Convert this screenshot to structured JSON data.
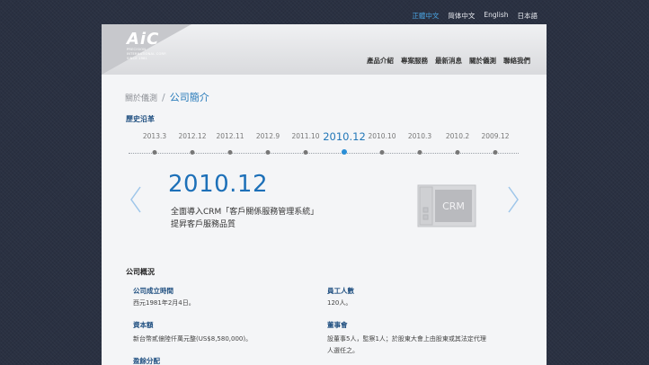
{
  "languages": [
    {
      "label": "正體中文",
      "active": true
    },
    {
      "label": "简体中文",
      "active": false
    },
    {
      "label": "English",
      "active": false
    },
    {
      "label": "日本語",
      "active": false
    }
  ],
  "logo": {
    "text": "AiC",
    "line1": "PRECISION INTERNATIONAL CORP.",
    "line2": "SINCE 1981"
  },
  "nav": [
    "產品介紹",
    "專案服務",
    "最新消息",
    "關於儀測",
    "聯絡我們"
  ],
  "breadcrumb": {
    "parent": "關於儀測",
    "separator": "/",
    "current": "公司簡介"
  },
  "history": {
    "title": "歷史沿革",
    "years": [
      "2013.3",
      "2012.12",
      "2012.11",
      "2012.9",
      "2011.10",
      "2010.12",
      "2010.10",
      "2010.3",
      "2010.2",
      "2009.12"
    ],
    "active_index": 5,
    "active_year": "2010.12",
    "lines": [
      "全面導入CRM「客戶關係服務管理系統」",
      "提昇客戶服務品質"
    ],
    "icon_label": "CRM",
    "icon_name": "crm-icon"
  },
  "overview": {
    "title": "公司概況",
    "founded_label": "公司成立時間",
    "founded_value": "西元1981年2月4日。",
    "employees_label": "員工人數",
    "employees_value": "120人。",
    "capital_label": "資本額",
    "capital_value": "新台幣貳億陸仟萬元整(US$8,580,000)。",
    "board_label": "董事會",
    "board_value_1": "設董事5人，監察1人；於股東大會上由股東或其法定代理",
    "board_value_2": "人選任之。",
    "dividend_label": "盈餘分配"
  },
  "colors": {
    "accent": "#2277b8",
    "label_blue": "#1f4f80",
    "background": "#2a3142"
  }
}
